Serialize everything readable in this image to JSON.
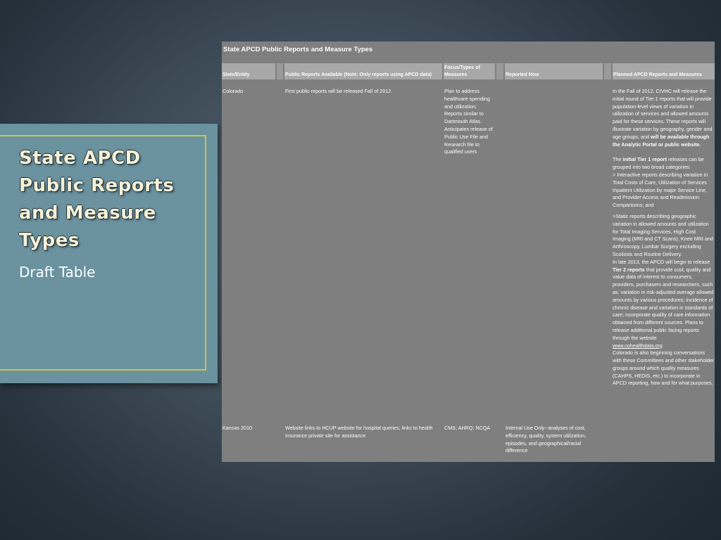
{
  "slide": {
    "title": "State APCD Public Reports and Measure Types",
    "subtitle": "Draft Table"
  },
  "table": {
    "title": "State APCD Public Reports and Measure Types",
    "headers": {
      "state": "State/Entity",
      "reports": "Public Reports Available (Note:  Only reports using APCD data)",
      "focus_line1": "Focus/Types of",
      "focus_line2": "Measures",
      "now": "Reported Now",
      "planned": "Planned APCD Reports and Measures"
    },
    "rows": {
      "colorado": {
        "state": "Colorado",
        "reports": "First public reports will be released Fall of 2012.",
        "focus": "Plan to address healthcare spending and utilization; Reports similar to Dartmouth Atlas. Anticipates release of Public Use File and Research file to qualified users",
        "planned": {
          "p1_text": "In the Fall of 2012, CIVHC will release the initial round of Tier 1 reports that will provide population-level views of variation in utilization of services and allowed amounts paid for these services. These reports will illustrate variation by geography, gender and age groups, and ",
          "p1_bold": "will be available through the Analytic Portal or public website.",
          "p2_pre": "The ",
          "p2_bold": "initial Tier 1 report",
          "p2_post": " releases can be grouped into two broad categories:",
          "p2_line2": "> Interactive reports describing variation in Total Costs of Care, Utilization of Services Inpatient Utilization by major Service Line, and Provider Access and Readmission Comparisons;  and",
          "p3": ">Static reports describing geographic variation in allowed amounts and utilization for Total Imaging Services, High Cost Imaging (MRI and CT Scans), Knee MRI and Arthroscopy, Lumbar Surgery excluding Scoliosis and Routine Delivery.",
          "p4_pre": "In late 2013, the APCD will begin to release ",
          "p4_bold": "Tier 2 reports",
          "p4_post": " that provide cost, quality and value data of interest to consumers, providers, purchasers and researchers, such as: variation in risk-adjusted average allowed amounts by various procedures; incidence of chronic disease and variation in standards of care; incorporate quality of care information obtained from different sources. Plans to release additional public facing reports through the website",
          "link": "www.cohealthdata.org",
          "p5": "Colorado is also beginning conversations with these Committees and other stakeholder groups around which quality measures (CAHPS, HEDIS, etc.) to incorporate in APCD reporting, how and for what purposes."
        }
      },
      "kansas": {
        "state": "Kansas 2010",
        "reports": "Website links to HCUP website for hospital queries; links to health insurance private site for assistance",
        "focus": "CMS; AHRQ; NCQA",
        "now": "Internal Use Only--analyses of cost, efficiency, quality, system utilization, episodes, and geographical/racial difference"
      }
    }
  }
}
